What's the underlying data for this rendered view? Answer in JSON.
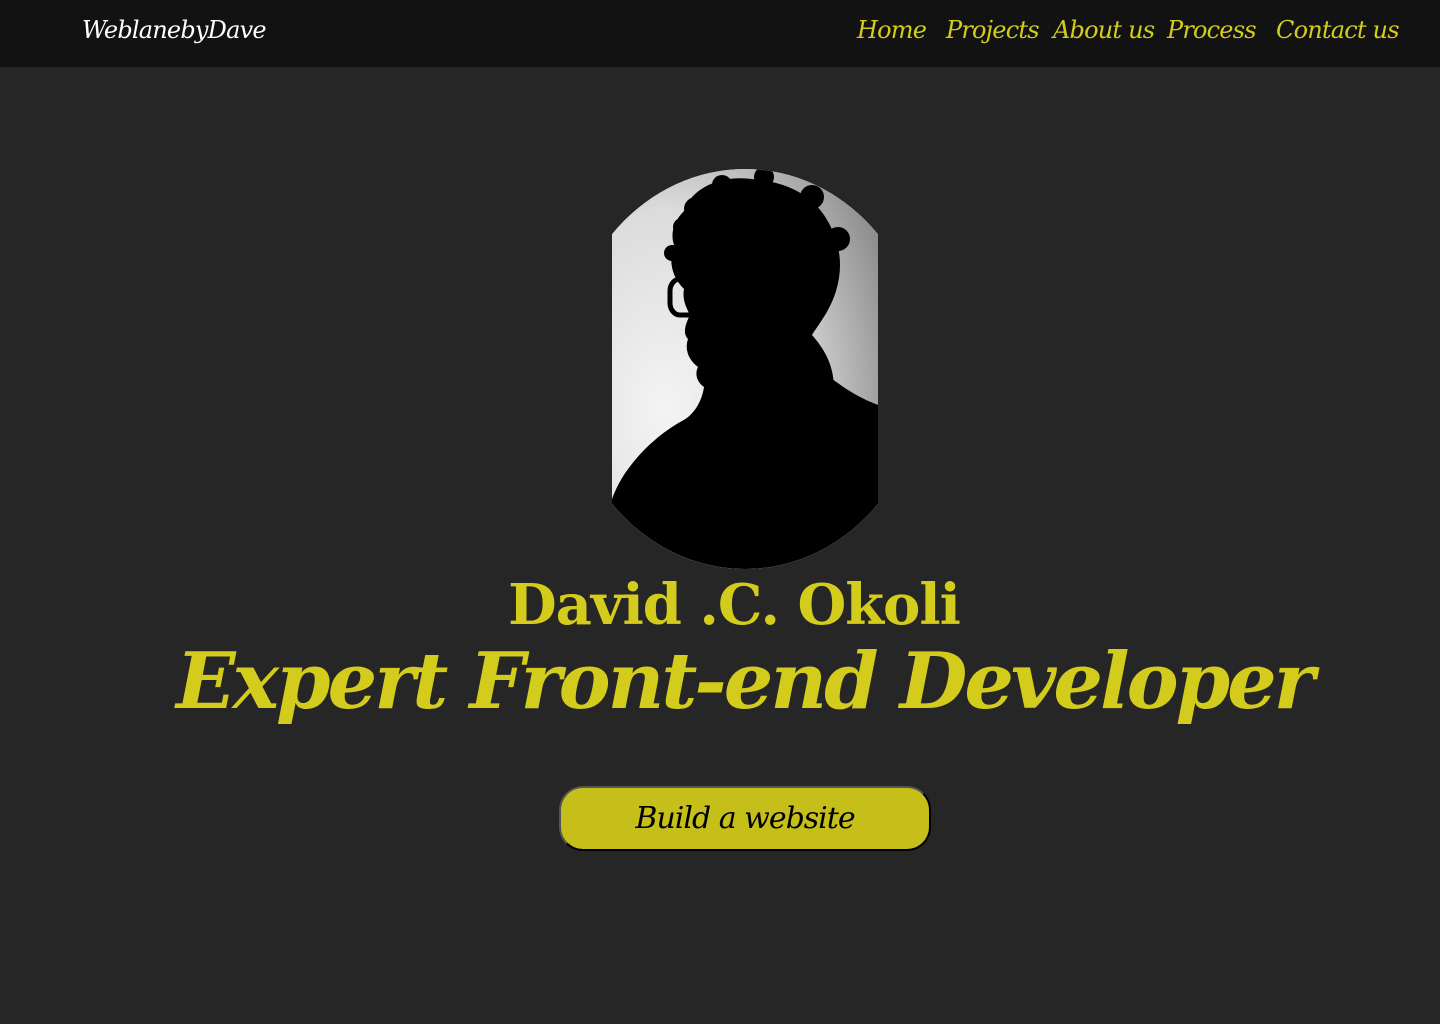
{
  "brand": {
    "name": "WeblanebyDave"
  },
  "nav": {
    "items": [
      {
        "label": "Home"
      },
      {
        "label": "Projects"
      },
      {
        "label": "About us"
      },
      {
        "label": "Process"
      },
      {
        "label": "Contact us"
      }
    ]
  },
  "hero": {
    "name": "David .C. Okoli",
    "title": "Expert Front-end Developer",
    "cta_label": "Build a website"
  },
  "colors": {
    "page_background": "#262626",
    "navbar_background": "#121212",
    "accent": "#d4cc1c",
    "button_background": "#c6bf19",
    "button_text": "#000000",
    "brand_text": "#ffffff"
  },
  "icons": {
    "portrait": "silhouette-portrait-photo"
  }
}
